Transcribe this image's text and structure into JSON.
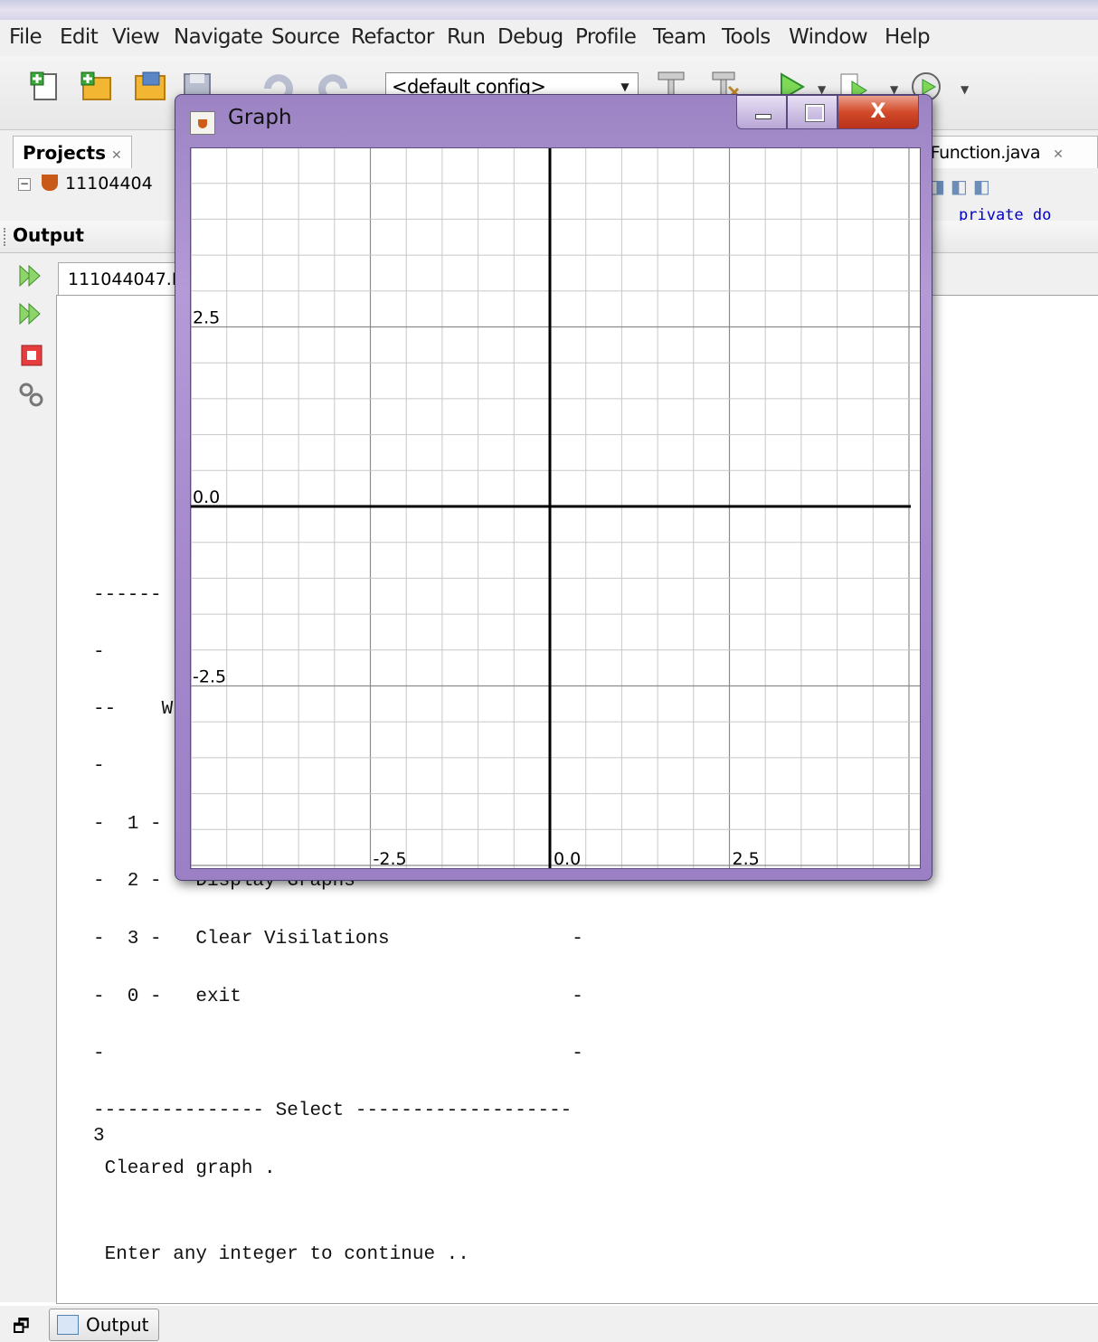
{
  "menubar": {
    "items": [
      "File",
      "Edit",
      "View",
      "Navigate",
      "Source",
      "Refactor",
      "Run",
      "Debug",
      "Profile",
      "Team",
      "Tools",
      "Window",
      "Help"
    ]
  },
  "toolbar": {
    "config_value": "<default config>",
    "icons": [
      "new-file-icon",
      "new-project-icon",
      "open-project-icon",
      "save-all-icon",
      "undo-icon",
      "redo-icon",
      "build-icon",
      "clean-build-icon",
      "run-icon",
      "debug-icon",
      "profile-icon"
    ]
  },
  "projects": {
    "tab_label": "Projects",
    "tree_root": "11104404"
  },
  "editor": {
    "tab_label": "nFunction.java",
    "code_peek": "private do"
  },
  "output": {
    "title": "Output",
    "subtab_label": "111044047.H",
    "console_lines": [
      "------",
      "-",
      "--    W",
      "-",
      "-  1 -",
      "-  2 -   Display Graphs                   -",
      "-  3 -   Clear Visilations                -",
      "-  0 -   exit                             -",
      "-                                         -",
      "--------------- Select -------------------",
      "3",
      " Cleared graph .",
      "",
      " Enter any integer to continue .."
    ]
  },
  "bottom": {
    "output_tab_label": "Output"
  },
  "graph_window": {
    "title": "Graph",
    "close_label": "X",
    "y_tick_labels": [
      "2.5",
      "0.0",
      "-2.5"
    ],
    "x_tick_labels": [
      "-2.5",
      "0.0",
      "2.5"
    ]
  },
  "colors": {
    "window_frame": "#a589cc",
    "close_button": "#d24a2a",
    "grid_minor": "#c8c8c8",
    "grid_major": "#8c8c8c",
    "axis": "#000000"
  }
}
